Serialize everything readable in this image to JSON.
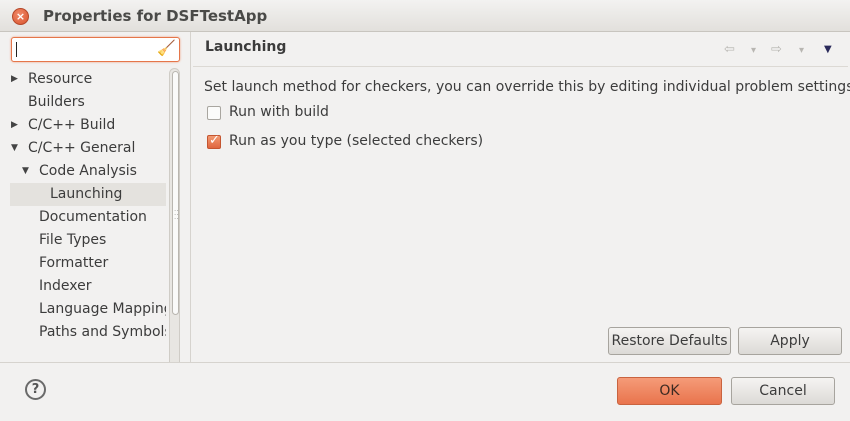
{
  "window": {
    "title": "Properties for DSFTestApp",
    "close_glyph": "×"
  },
  "filter": {
    "value": "",
    "clear_icon": "broom-icon"
  },
  "tree": {
    "items": [
      {
        "label": "Resource",
        "arrow": "▶",
        "expanded": false,
        "selected": false
      },
      {
        "label": "Builders",
        "arrow": "",
        "expanded": false,
        "selected": false
      },
      {
        "label": "C/C++ Build",
        "arrow": "▶",
        "expanded": false,
        "selected": false
      },
      {
        "label": "C/C++ General",
        "arrow": "▼",
        "expanded": true,
        "selected": false
      },
      {
        "label": "Code Analysis",
        "arrow": "▼",
        "expanded": true,
        "selected": false
      },
      {
        "label": "Launching",
        "arrow": "",
        "expanded": false,
        "selected": true
      },
      {
        "label": "Documentation",
        "arrow": "",
        "expanded": false,
        "selected": false
      },
      {
        "label": "File Types",
        "arrow": "",
        "expanded": false,
        "selected": false
      },
      {
        "label": "Formatter",
        "arrow": "",
        "expanded": false,
        "selected": false
      },
      {
        "label": "Indexer",
        "arrow": "",
        "expanded": false,
        "selected": false
      },
      {
        "label": "Language Mapping",
        "arrow": "",
        "expanded": false,
        "selected": false
      },
      {
        "label": "Paths and Symbols",
        "arrow": "",
        "expanded": false,
        "selected": false
      }
    ]
  },
  "page": {
    "title": "Launching",
    "description": "Set launch method for checkers, you can override this by editing individual problem settings",
    "nav": {
      "back": "⇦",
      "back_menu": "▾",
      "forward": "⇨",
      "forward_menu": "▾",
      "view_menu": "▼"
    },
    "options": [
      {
        "label": "Run with build",
        "checked": false
      },
      {
        "label": "Run as you type (selected checkers)",
        "checked": true
      }
    ],
    "restore_defaults_label": "Restore Defaults",
    "apply_label": "Apply"
  },
  "footer": {
    "help_glyph": "?",
    "ok_label": "OK",
    "cancel_label": "Cancel"
  },
  "colors": {
    "accent": "#e9744d",
    "focus_border": "#e5764a"
  }
}
